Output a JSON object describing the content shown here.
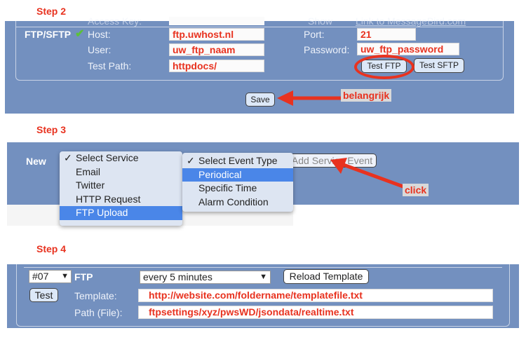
{
  "step2": {
    "label": "Step 2",
    "access_key_label": "Access Key:",
    "show_label": "Show",
    "messagebird_link": "Link to MessageBird.com",
    "section": "FTP/SFTP",
    "host_label": "Host:",
    "host": "ftp.uwhost.nl",
    "user_label": "User:",
    "user": "uw_ftp_naam",
    "testpath_label": "Test Path:",
    "testpath": "httpdocs/",
    "port_label": "Port:",
    "port": "21",
    "password_label": "Password:",
    "password": "uw_ftp_password",
    "test_ftp": "Test FTP",
    "test_sftp": "Test SFTP",
    "save": "Save",
    "annotation": "belangrijk"
  },
  "step3": {
    "label": "Step 3",
    "new_label": "New",
    "service_menu": [
      "Select Service",
      "Email",
      "Twitter",
      "HTTP Request",
      "FTP Upload"
    ],
    "event_menu": [
      "Select Event Type",
      "Periodical",
      "Specific Time",
      "Alarm Condition"
    ],
    "add_button": "Add Service Event",
    "annotation": "click"
  },
  "step4": {
    "label": "Step 4",
    "slot": "#07",
    "type": "FTP",
    "interval": "every 5 minutes",
    "reload": "Reload Template",
    "test": "Test",
    "template_label": "Template:",
    "template": "http://website.com/foldername/templatefile.txt",
    "path_label": "Path (File):",
    "path": "ftpsettings/xyz/pwsWD/jsondata/realtime.txt"
  },
  "colors": {
    "panel": "#7390bf",
    "annotation": "#e8321f",
    "highlight": "#4a86e8"
  }
}
